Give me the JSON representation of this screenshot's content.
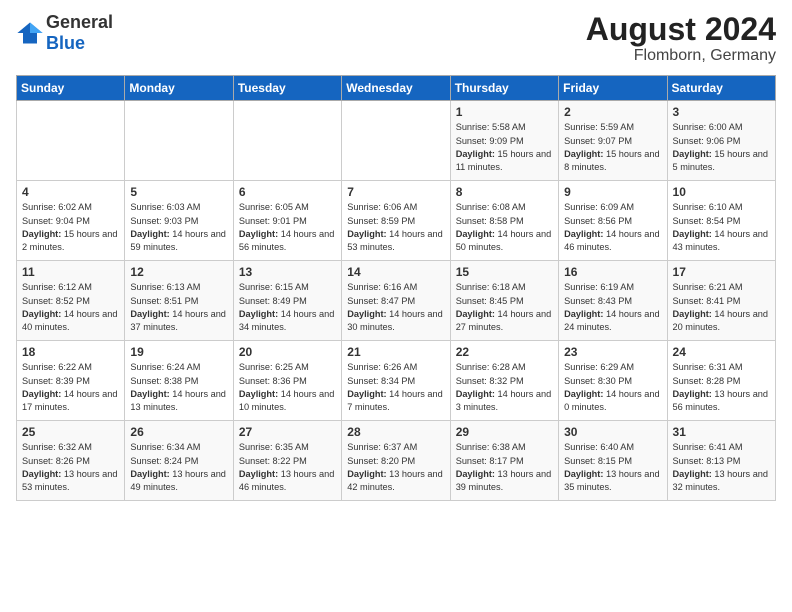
{
  "header": {
    "logo_general": "General",
    "logo_blue": "Blue",
    "month_year": "August 2024",
    "location": "Flomborn, Germany"
  },
  "days_of_week": [
    "Sunday",
    "Monday",
    "Tuesday",
    "Wednesday",
    "Thursday",
    "Friday",
    "Saturday"
  ],
  "weeks": [
    [
      {
        "day": "",
        "info": ""
      },
      {
        "day": "",
        "info": ""
      },
      {
        "day": "",
        "info": ""
      },
      {
        "day": "",
        "info": ""
      },
      {
        "day": "1",
        "info": "Sunrise: 5:58 AM\nSunset: 9:09 PM\nDaylight: 15 hours and 11 minutes."
      },
      {
        "day": "2",
        "info": "Sunrise: 5:59 AM\nSunset: 9:07 PM\nDaylight: 15 hours and 8 minutes."
      },
      {
        "day": "3",
        "info": "Sunrise: 6:00 AM\nSunset: 9:06 PM\nDaylight: 15 hours and 5 minutes."
      }
    ],
    [
      {
        "day": "4",
        "info": "Sunrise: 6:02 AM\nSunset: 9:04 PM\nDaylight: 15 hours and 2 minutes."
      },
      {
        "day": "5",
        "info": "Sunrise: 6:03 AM\nSunset: 9:03 PM\nDaylight: 14 hours and 59 minutes."
      },
      {
        "day": "6",
        "info": "Sunrise: 6:05 AM\nSunset: 9:01 PM\nDaylight: 14 hours and 56 minutes."
      },
      {
        "day": "7",
        "info": "Sunrise: 6:06 AM\nSunset: 8:59 PM\nDaylight: 14 hours and 53 minutes."
      },
      {
        "day": "8",
        "info": "Sunrise: 6:08 AM\nSunset: 8:58 PM\nDaylight: 14 hours and 50 minutes."
      },
      {
        "day": "9",
        "info": "Sunrise: 6:09 AM\nSunset: 8:56 PM\nDaylight: 14 hours and 46 minutes."
      },
      {
        "day": "10",
        "info": "Sunrise: 6:10 AM\nSunset: 8:54 PM\nDaylight: 14 hours and 43 minutes."
      }
    ],
    [
      {
        "day": "11",
        "info": "Sunrise: 6:12 AM\nSunset: 8:52 PM\nDaylight: 14 hours and 40 minutes."
      },
      {
        "day": "12",
        "info": "Sunrise: 6:13 AM\nSunset: 8:51 PM\nDaylight: 14 hours and 37 minutes."
      },
      {
        "day": "13",
        "info": "Sunrise: 6:15 AM\nSunset: 8:49 PM\nDaylight: 14 hours and 34 minutes."
      },
      {
        "day": "14",
        "info": "Sunrise: 6:16 AM\nSunset: 8:47 PM\nDaylight: 14 hours and 30 minutes."
      },
      {
        "day": "15",
        "info": "Sunrise: 6:18 AM\nSunset: 8:45 PM\nDaylight: 14 hours and 27 minutes."
      },
      {
        "day": "16",
        "info": "Sunrise: 6:19 AM\nSunset: 8:43 PM\nDaylight: 14 hours and 24 minutes."
      },
      {
        "day": "17",
        "info": "Sunrise: 6:21 AM\nSunset: 8:41 PM\nDaylight: 14 hours and 20 minutes."
      }
    ],
    [
      {
        "day": "18",
        "info": "Sunrise: 6:22 AM\nSunset: 8:39 PM\nDaylight: 14 hours and 17 minutes."
      },
      {
        "day": "19",
        "info": "Sunrise: 6:24 AM\nSunset: 8:38 PM\nDaylight: 14 hours and 13 minutes."
      },
      {
        "day": "20",
        "info": "Sunrise: 6:25 AM\nSunset: 8:36 PM\nDaylight: 14 hours and 10 minutes."
      },
      {
        "day": "21",
        "info": "Sunrise: 6:26 AM\nSunset: 8:34 PM\nDaylight: 14 hours and 7 minutes."
      },
      {
        "day": "22",
        "info": "Sunrise: 6:28 AM\nSunset: 8:32 PM\nDaylight: 14 hours and 3 minutes."
      },
      {
        "day": "23",
        "info": "Sunrise: 6:29 AM\nSunset: 8:30 PM\nDaylight: 14 hours and 0 minutes."
      },
      {
        "day": "24",
        "info": "Sunrise: 6:31 AM\nSunset: 8:28 PM\nDaylight: 13 hours and 56 minutes."
      }
    ],
    [
      {
        "day": "25",
        "info": "Sunrise: 6:32 AM\nSunset: 8:26 PM\nDaylight: 13 hours and 53 minutes."
      },
      {
        "day": "26",
        "info": "Sunrise: 6:34 AM\nSunset: 8:24 PM\nDaylight: 13 hours and 49 minutes."
      },
      {
        "day": "27",
        "info": "Sunrise: 6:35 AM\nSunset: 8:22 PM\nDaylight: 13 hours and 46 minutes."
      },
      {
        "day": "28",
        "info": "Sunrise: 6:37 AM\nSunset: 8:20 PM\nDaylight: 13 hours and 42 minutes."
      },
      {
        "day": "29",
        "info": "Sunrise: 6:38 AM\nSunset: 8:17 PM\nDaylight: 13 hours and 39 minutes."
      },
      {
        "day": "30",
        "info": "Sunrise: 6:40 AM\nSunset: 8:15 PM\nDaylight: 13 hours and 35 minutes."
      },
      {
        "day": "31",
        "info": "Sunrise: 6:41 AM\nSunset: 8:13 PM\nDaylight: 13 hours and 32 minutes."
      }
    ]
  ]
}
